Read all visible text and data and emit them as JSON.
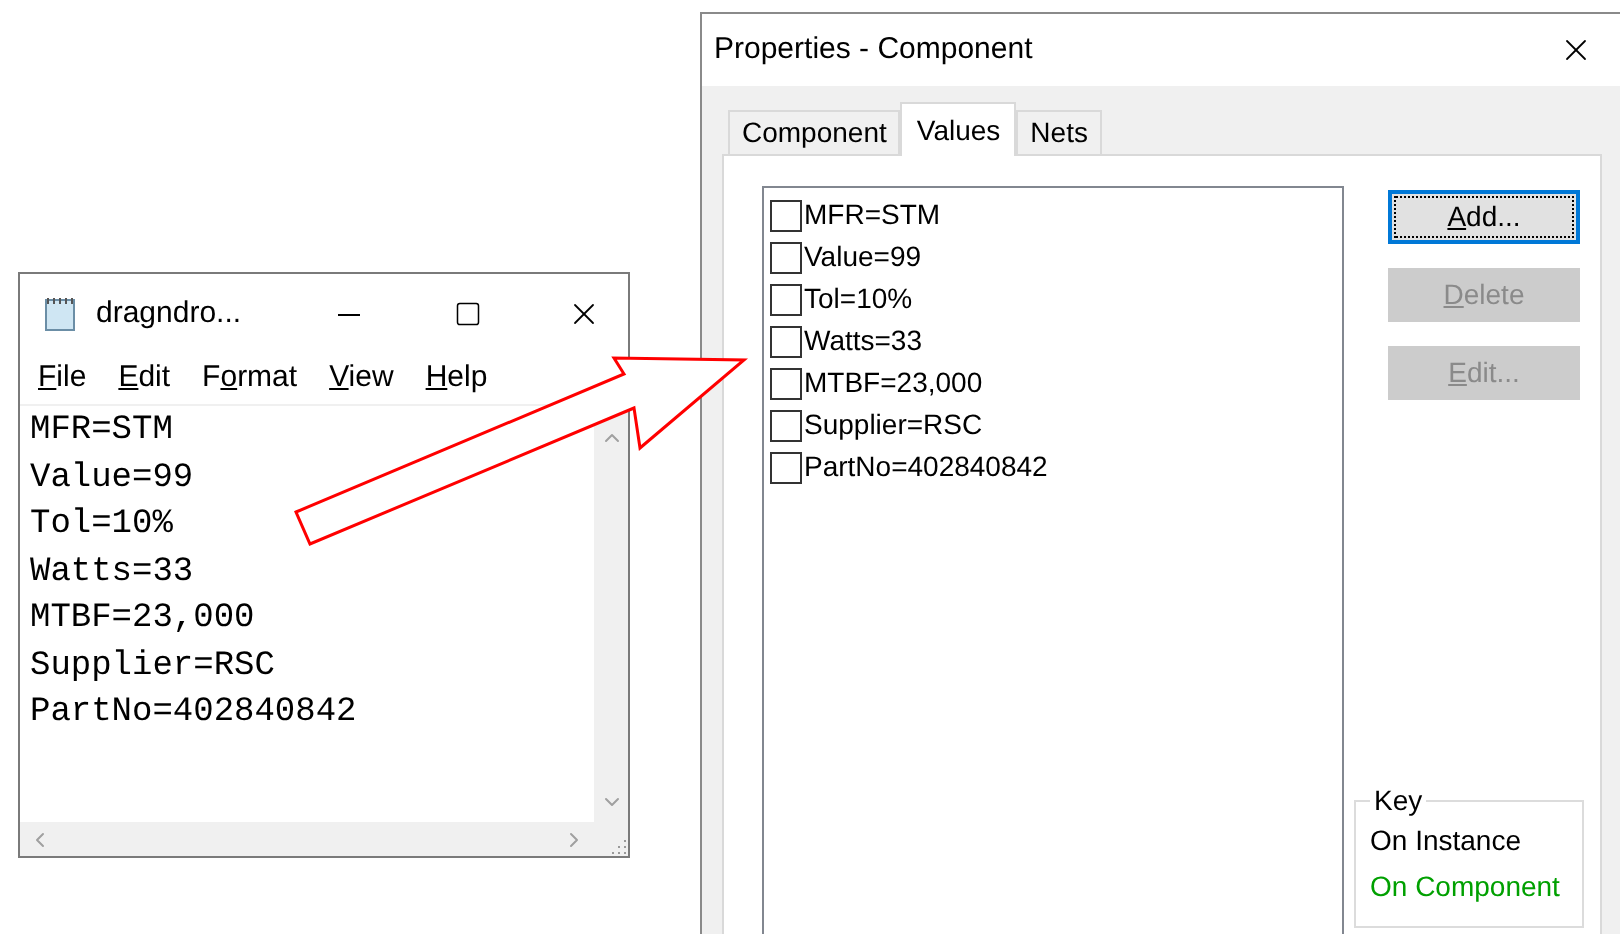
{
  "notepad": {
    "title": "dragndro...",
    "menu": [
      {
        "accel": "F",
        "post": "ile"
      },
      {
        "accel": "E",
        "post": "dit"
      },
      {
        "pre": "F",
        "accel": "o",
        "post": "rmat"
      },
      {
        "accel": "V",
        "post": "iew"
      },
      {
        "accel": "H",
        "post": "elp"
      }
    ],
    "lines": [
      "MFR=STM",
      "Value=99",
      "Tol=10%",
      "Watts=33",
      "MTBF=23,000",
      "Supplier=RSC",
      "PartNo=402840842"
    ]
  },
  "properties": {
    "title": "Properties - Component",
    "tabs": [
      {
        "label": "Component",
        "selected": false
      },
      {
        "label": "Values",
        "selected": true
      },
      {
        "label": "Nets",
        "selected": false
      }
    ],
    "values": [
      {
        "label": "MFR=STM",
        "checked": false
      },
      {
        "label": "Value=99",
        "checked": false
      },
      {
        "label": "Tol=10%",
        "checked": false
      },
      {
        "label": "Watts=33",
        "checked": false
      },
      {
        "label": "MTBF=23,000",
        "checked": false
      },
      {
        "label": "Supplier=RSC",
        "checked": false
      },
      {
        "label": "PartNo=402840842",
        "checked": false
      }
    ],
    "buttons": [
      {
        "accel": "A",
        "post": "dd...",
        "disabled": false,
        "focused": true
      },
      {
        "accel": "D",
        "post": "elete",
        "disabled": true,
        "focused": false
      },
      {
        "accel": "E",
        "post": "dit...",
        "disabled": true,
        "focused": false
      }
    ],
    "key": {
      "title": "Key",
      "items": [
        {
          "label": "On Instance",
          "color": "#000000"
        },
        {
          "label": "On Component",
          "color": "#00a000"
        }
      ]
    }
  }
}
